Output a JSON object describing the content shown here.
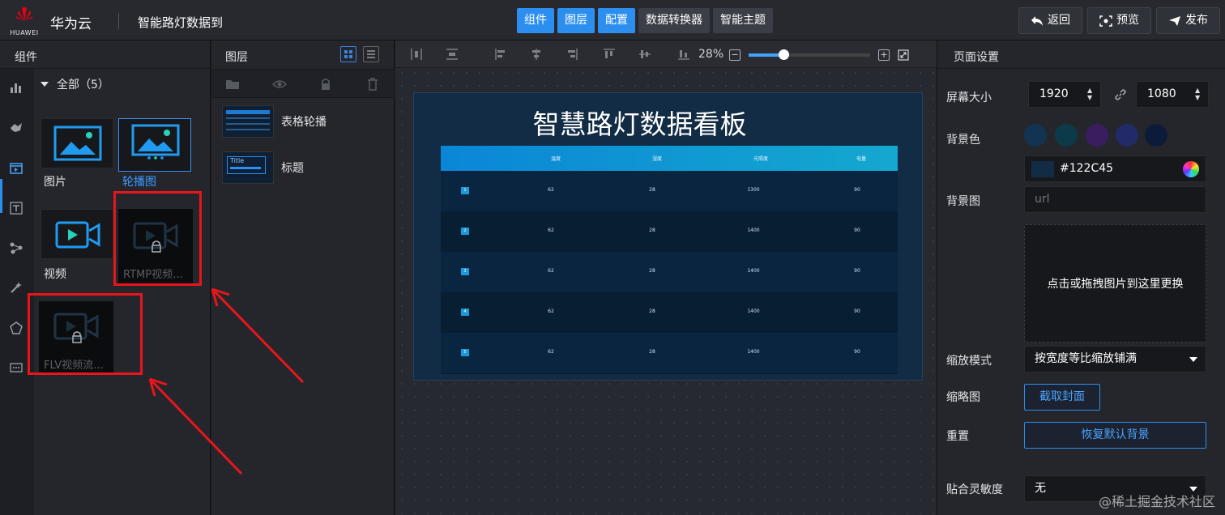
{
  "header": {
    "logo_text": "HUAWEI",
    "brand": "华为云",
    "project_title": "智能路灯数据到",
    "tabs": [
      {
        "label": "组件",
        "active": true
      },
      {
        "label": "图层",
        "active": true
      },
      {
        "label": "配置",
        "active": true
      },
      {
        "label": "数据转换器",
        "active": false
      },
      {
        "label": "智能主题",
        "active": false
      }
    ],
    "back_label": "返回",
    "preview_label": "预览",
    "publish_label": "发布"
  },
  "components": {
    "title": "组件",
    "all_label": "全部（5）",
    "items": [
      {
        "label": "图片",
        "locked": false,
        "selected": false
      },
      {
        "label": "轮播图",
        "locked": false,
        "selected": true
      },
      {
        "label": "视频",
        "locked": false,
        "selected": false
      },
      {
        "label": "RTMP视频…",
        "locked": true,
        "selected": false
      },
      {
        "label": "FLV视频流…",
        "locked": true,
        "selected": false
      }
    ]
  },
  "layers": {
    "title": "图层",
    "items": [
      {
        "label": "表格轮播"
      },
      {
        "label": "标题",
        "thumb_text": "Title"
      }
    ]
  },
  "canvas": {
    "zoom": "28%",
    "zoom_value": 0.28,
    "board_title": "智慧路灯数据看板",
    "table_headers": [
      "温度",
      "湿度",
      "光照度",
      "电量"
    ],
    "rows": [
      {
        "no": "1",
        "cells": [
          "62",
          "28",
          "1300",
          "90"
        ]
      },
      {
        "no": "2",
        "cells": [
          "62",
          "28",
          "1400",
          "90"
        ]
      },
      {
        "no": "3",
        "cells": [
          "62",
          "28",
          "1400",
          "90"
        ]
      },
      {
        "no": "4",
        "cells": [
          "62",
          "28",
          "1400",
          "90"
        ]
      },
      {
        "no": "5",
        "cells": [
          "62",
          "28",
          "1400",
          "90"
        ]
      }
    ]
  },
  "settings": {
    "title": "页面设置",
    "screen_size_label": "屏幕大小",
    "width": "1920",
    "height": "1080",
    "bg_color_label": "背景色",
    "swatches": [
      "#123452",
      "#0c3a48",
      "#3a1d5e",
      "#232a6a",
      "#0d1b3a"
    ],
    "bg_color_value": "#122C45",
    "bg_image_label": "背景图",
    "url_placeholder": "url",
    "drop_text": "点击或拖拽图片到这里更换",
    "scale_mode_label": "缩放模式",
    "scale_mode_value": "按宽度等比缩放铺满",
    "thumb_label": "缩略图",
    "capture_label": "截取封面",
    "reset_label": "重置",
    "restore_label": "恢复默认背景",
    "snap_label": "贴合灵敏度",
    "snap_value": "无"
  },
  "watermark": "@稀土掘金技术社区",
  "colors": {
    "accent": "#2c8ff0",
    "highlight_box": "#e8161a",
    "panel_bg": "#24262c",
    "board_bg": "#122c45"
  }
}
